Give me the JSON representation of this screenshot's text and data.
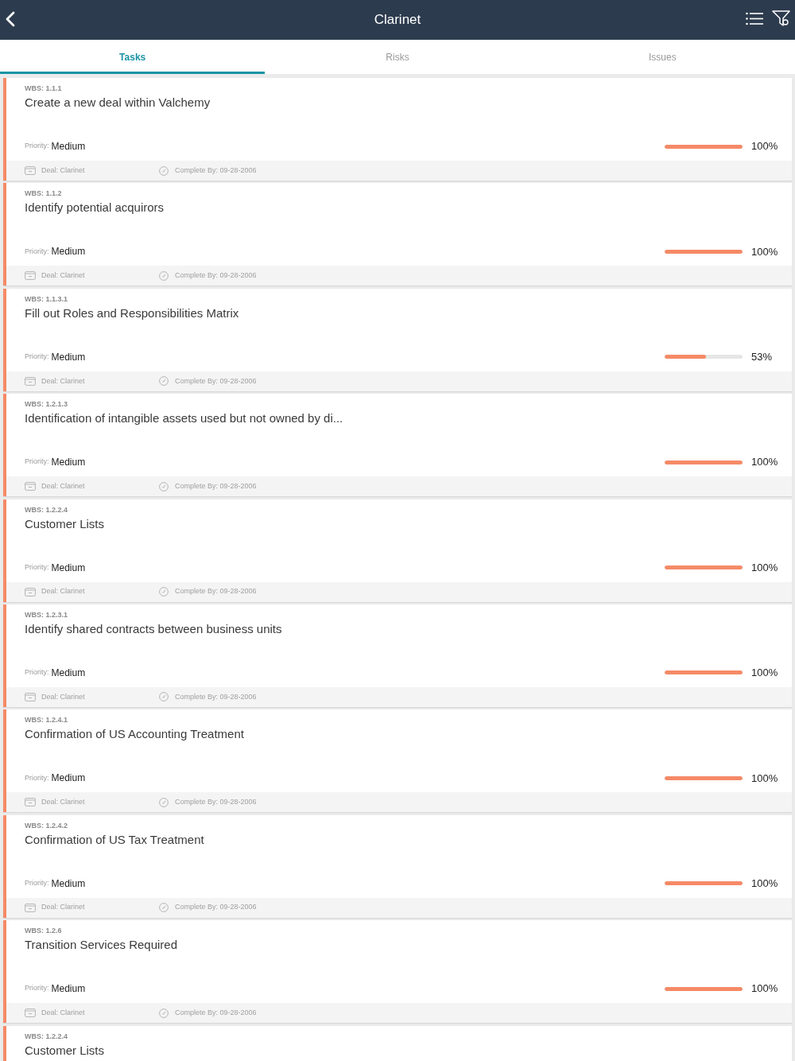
{
  "header": {
    "title": "Clarinet"
  },
  "tabs": [
    {
      "label": "Tasks",
      "selected": true
    },
    {
      "label": "Risks",
      "selected": false
    },
    {
      "label": "Issues",
      "selected": false
    }
  ],
  "tasks": [
    {
      "wbs": "WBS: 1.1.1",
      "title": "Create a new deal within Valchemy",
      "priority_label": "Priority:",
      "priority": "Medium",
      "level": 1,
      "percent": "100%",
      "deal": "Deal: Clarinet",
      "complete_by": "Complete By: 09-28-2006"
    },
    {
      "wbs": "WBS: 1.1.2",
      "title": "Identify potential acquirors",
      "priority_label": "Priority:",
      "priority": "Medium",
      "level": 1,
      "percent": "100%",
      "deal": "Deal: Clarinet",
      "complete_by": "Complete By: 09-28-2006"
    },
    {
      "wbs": "WBS: 1.1.3.1",
      "title": "Fill out Roles and Responsibilities Matrix",
      "priority_label": "Priority:",
      "priority": "Medium",
      "level": 0.53,
      "percent": "53%",
      "deal": "Deal: Clarinet",
      "complete_by": "Complete By: 09-28-2006"
    },
    {
      "wbs": "WBS: 1.2.1.3",
      "title": "Identification of intangible assets used but not owned by di...",
      "priority_label": "Priority:",
      "priority": "Medium",
      "level": 1,
      "percent": "100%",
      "deal": "Deal: Clarinet",
      "complete_by": "Complete By: 09-28-2006"
    },
    {
      "wbs": "WBS: 1.2.2.4",
      "title": "Customer Lists",
      "priority_label": "Priority:",
      "priority": "Medium",
      "level": 1,
      "percent": "100%",
      "deal": "Deal: Clarinet",
      "complete_by": "Complete By: 09-28-2006"
    },
    {
      "wbs": "WBS: 1.2.3.1",
      "title": "Identify shared contracts between business units",
      "priority_label": "Priority:",
      "priority": "Medium",
      "level": 1,
      "percent": "100%",
      "deal": "Deal: Clarinet",
      "complete_by": "Complete By: 09-28-2006"
    },
    {
      "wbs": "WBS: 1.2.4.1",
      "title": "Confirmation of US Accounting Treatment",
      "priority_label": "Priority:",
      "priority": "Medium",
      "level": 1,
      "percent": "100%",
      "deal": "Deal: Clarinet",
      "complete_by": "Complete By: 09-28-2006"
    },
    {
      "wbs": "WBS: 1.2.4.2",
      "title": "Confirmation of US Tax Treatment",
      "priority_label": "Priority:",
      "priority": "Medium",
      "level": 1,
      "percent": "100%",
      "deal": "Deal: Clarinet",
      "complete_by": "Complete By: 09-28-2006"
    },
    {
      "wbs": "WBS: 1.2.6",
      "title": "Transition Services Required",
      "priority_label": "Priority:",
      "priority": "Medium",
      "level": 1,
      "percent": "100%",
      "deal": "Deal: Clarinet",
      "complete_by": "Complete By: 09-28-2006"
    },
    {
      "wbs": "WBS: 1.2.2.4",
      "title": "Customer Lists"
    }
  ]
}
